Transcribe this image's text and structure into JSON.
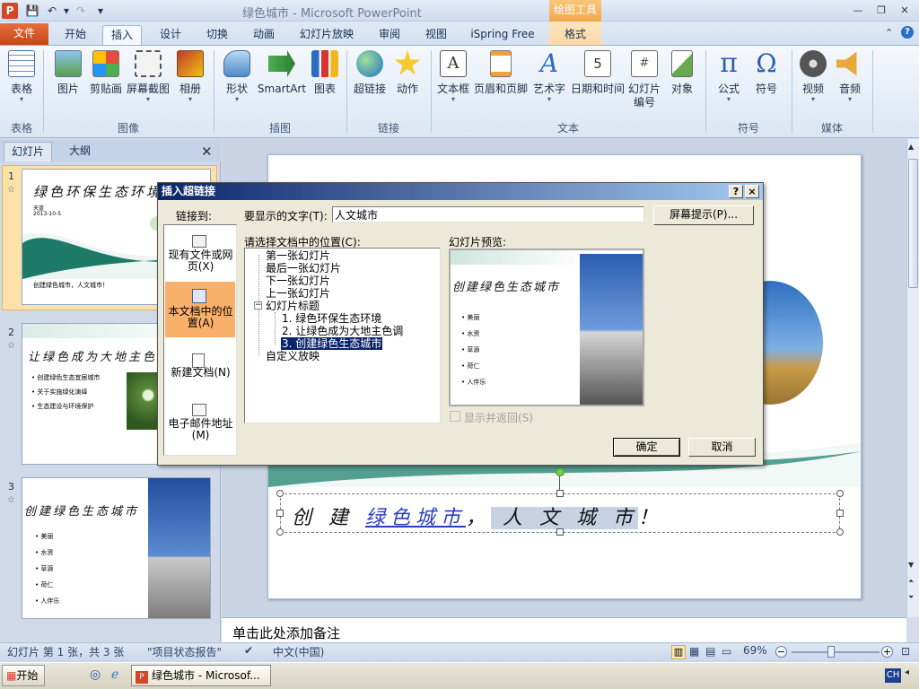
{
  "window": {
    "app_icon": "P",
    "title": "绿色城市 - Microsoft PowerPoint",
    "context_tab_title": "绘图工具"
  },
  "tabs": [
    "文件",
    "开始",
    "插入",
    "设计",
    "切换",
    "动画",
    "幻灯片放映",
    "审阅",
    "视图",
    "iSpring Free",
    "格式"
  ],
  "ribbon": {
    "groups": [
      "表格",
      "图像",
      "插图",
      "链接",
      "文本",
      "符号",
      "媒体"
    ],
    "buttons": {
      "table": "表格",
      "picture": "图片",
      "clipart": "剪贴画",
      "screenshot": "屏幕截图",
      "album": "相册",
      "shapes": "形状",
      "smartart": "SmartArt",
      "chart": "图表",
      "hyperlink": "超链接",
      "action": "动作",
      "textbox": "文本框",
      "headerfooter": "页眉和页脚",
      "wordart": "艺术字",
      "datetime": "日期和时间",
      "slidenum1": "幻灯片",
      "slidenum2": "编号",
      "object": "对象",
      "equation": "公式",
      "symbol": "符号",
      "video": "视频",
      "audio": "音频"
    }
  },
  "panel": {
    "tab_slides": "幻灯片",
    "tab_outline": "大纲",
    "slides": [
      {
        "num": "1",
        "title": "绿色环保生态环境",
        "date": "2013-10-5",
        "author": "天蓝",
        "footer": "创建绿色城市，人文城市！"
      },
      {
        "num": "2",
        "title": "让绿色成为大地主色调",
        "bullets": [
          "创建绿色生态宜居城市",
          "关于实施绿化演绎",
          "生态建设与环境保护"
        ]
      },
      {
        "num": "3",
        "title": "创建绿色生态城市",
        "bullets": [
          "美丽",
          "水资",
          "草源",
          "荷仁",
          "人伴乐"
        ]
      }
    ]
  },
  "slide": {
    "text_part1": "创 建 ",
    "text_link": "绿色城市",
    "text_part2": "，",
    "text_selected": " 人 文 城 市",
    "text_part3": "！"
  },
  "notes_placeholder": "单击此处添加备注",
  "status": {
    "slide_info": "幻灯片 第 1 张，共 3 张",
    "theme": "\"项目状态报告\"",
    "language": "中文(中国)",
    "zoom": "69%",
    "zoom_fraction": 0.45
  },
  "taskbar": {
    "start": "开始",
    "task": "绿色城市 - Microsof...",
    "ime": "CH"
  },
  "dialog": {
    "title": "插入超链接",
    "help": "?",
    "close": "×",
    "link_to": "链接到:",
    "display_text_label": "要显示的文字(T):",
    "display_text_value": "人文城市",
    "screentip": "屏幕提示(P)...",
    "place_label": "请选择文档中的位置(C):",
    "preview_label": "幻灯片预览:",
    "link_options": [
      "现有文件或网页(X)",
      "本文档中的位置(A)",
      "新建文档(N)",
      "电子邮件地址(M)"
    ],
    "tree": {
      "first": "第一张幻灯片",
      "last": "最后一张幻灯片",
      "next": "下一张幻灯片",
      "prev": "上一张幻灯片",
      "titles": "幻灯片标题",
      "t1": "1. 绿色环保生态环境",
      "t2": "2. 让绿色成为大地主色调",
      "t3": "3. 创建绿色生态城市",
      "custom": "自定义放映"
    },
    "preview": {
      "title": "创建绿色生态城市",
      "bullets": [
        "美丽",
        "水资",
        "草源",
        "荷仁",
        "人伴乐"
      ]
    },
    "show_return": "显示并返回(S)",
    "ok": "确定",
    "cancel": "取消"
  }
}
